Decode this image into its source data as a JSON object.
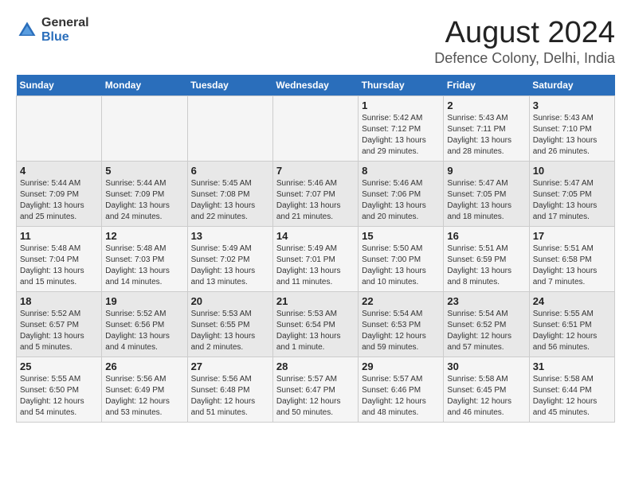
{
  "logo": {
    "general": "General",
    "blue": "Blue"
  },
  "title": "August 2024",
  "location": "Defence Colony, Delhi, India",
  "days_of_week": [
    "Sunday",
    "Monday",
    "Tuesday",
    "Wednesday",
    "Thursday",
    "Friday",
    "Saturday"
  ],
  "weeks": [
    [
      {
        "day": "",
        "info": ""
      },
      {
        "day": "",
        "info": ""
      },
      {
        "day": "",
        "info": ""
      },
      {
        "day": "",
        "info": ""
      },
      {
        "day": "1",
        "info": "Sunrise: 5:42 AM\nSunset: 7:12 PM\nDaylight: 13 hours\nand 29 minutes."
      },
      {
        "day": "2",
        "info": "Sunrise: 5:43 AM\nSunset: 7:11 PM\nDaylight: 13 hours\nand 28 minutes."
      },
      {
        "day": "3",
        "info": "Sunrise: 5:43 AM\nSunset: 7:10 PM\nDaylight: 13 hours\nand 26 minutes."
      }
    ],
    [
      {
        "day": "4",
        "info": "Sunrise: 5:44 AM\nSunset: 7:09 PM\nDaylight: 13 hours\nand 25 minutes."
      },
      {
        "day": "5",
        "info": "Sunrise: 5:44 AM\nSunset: 7:09 PM\nDaylight: 13 hours\nand 24 minutes."
      },
      {
        "day": "6",
        "info": "Sunrise: 5:45 AM\nSunset: 7:08 PM\nDaylight: 13 hours\nand 22 minutes."
      },
      {
        "day": "7",
        "info": "Sunrise: 5:46 AM\nSunset: 7:07 PM\nDaylight: 13 hours\nand 21 minutes."
      },
      {
        "day": "8",
        "info": "Sunrise: 5:46 AM\nSunset: 7:06 PM\nDaylight: 13 hours\nand 20 minutes."
      },
      {
        "day": "9",
        "info": "Sunrise: 5:47 AM\nSunset: 7:05 PM\nDaylight: 13 hours\nand 18 minutes."
      },
      {
        "day": "10",
        "info": "Sunrise: 5:47 AM\nSunset: 7:05 PM\nDaylight: 13 hours\nand 17 minutes."
      }
    ],
    [
      {
        "day": "11",
        "info": "Sunrise: 5:48 AM\nSunset: 7:04 PM\nDaylight: 13 hours\nand 15 minutes."
      },
      {
        "day": "12",
        "info": "Sunrise: 5:48 AM\nSunset: 7:03 PM\nDaylight: 13 hours\nand 14 minutes."
      },
      {
        "day": "13",
        "info": "Sunrise: 5:49 AM\nSunset: 7:02 PM\nDaylight: 13 hours\nand 13 minutes."
      },
      {
        "day": "14",
        "info": "Sunrise: 5:49 AM\nSunset: 7:01 PM\nDaylight: 13 hours\nand 11 minutes."
      },
      {
        "day": "15",
        "info": "Sunrise: 5:50 AM\nSunset: 7:00 PM\nDaylight: 13 hours\nand 10 minutes."
      },
      {
        "day": "16",
        "info": "Sunrise: 5:51 AM\nSunset: 6:59 PM\nDaylight: 13 hours\nand 8 minutes."
      },
      {
        "day": "17",
        "info": "Sunrise: 5:51 AM\nSunset: 6:58 PM\nDaylight: 13 hours\nand 7 minutes."
      }
    ],
    [
      {
        "day": "18",
        "info": "Sunrise: 5:52 AM\nSunset: 6:57 PM\nDaylight: 13 hours\nand 5 minutes."
      },
      {
        "day": "19",
        "info": "Sunrise: 5:52 AM\nSunset: 6:56 PM\nDaylight: 13 hours\nand 4 minutes."
      },
      {
        "day": "20",
        "info": "Sunrise: 5:53 AM\nSunset: 6:55 PM\nDaylight: 13 hours\nand 2 minutes."
      },
      {
        "day": "21",
        "info": "Sunrise: 5:53 AM\nSunset: 6:54 PM\nDaylight: 13 hours\nand 1 minute."
      },
      {
        "day": "22",
        "info": "Sunrise: 5:54 AM\nSunset: 6:53 PM\nDaylight: 12 hours\nand 59 minutes."
      },
      {
        "day": "23",
        "info": "Sunrise: 5:54 AM\nSunset: 6:52 PM\nDaylight: 12 hours\nand 57 minutes."
      },
      {
        "day": "24",
        "info": "Sunrise: 5:55 AM\nSunset: 6:51 PM\nDaylight: 12 hours\nand 56 minutes."
      }
    ],
    [
      {
        "day": "25",
        "info": "Sunrise: 5:55 AM\nSunset: 6:50 PM\nDaylight: 12 hours\nand 54 minutes."
      },
      {
        "day": "26",
        "info": "Sunrise: 5:56 AM\nSunset: 6:49 PM\nDaylight: 12 hours\nand 53 minutes."
      },
      {
        "day": "27",
        "info": "Sunrise: 5:56 AM\nSunset: 6:48 PM\nDaylight: 12 hours\nand 51 minutes."
      },
      {
        "day": "28",
        "info": "Sunrise: 5:57 AM\nSunset: 6:47 PM\nDaylight: 12 hours\nand 50 minutes."
      },
      {
        "day": "29",
        "info": "Sunrise: 5:57 AM\nSunset: 6:46 PM\nDaylight: 12 hours\nand 48 minutes."
      },
      {
        "day": "30",
        "info": "Sunrise: 5:58 AM\nSunset: 6:45 PM\nDaylight: 12 hours\nand 46 minutes."
      },
      {
        "day": "31",
        "info": "Sunrise: 5:58 AM\nSunset: 6:44 PM\nDaylight: 12 hours\nand 45 minutes."
      }
    ]
  ]
}
